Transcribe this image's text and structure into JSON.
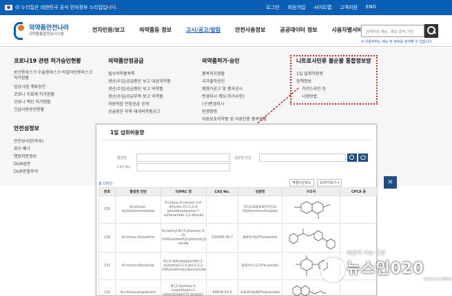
{
  "govbar": {
    "text": "이 누리집은 대한민국 공식 전자정부 누리집입니다.",
    "links": [
      "로그인",
      "회원가입",
      "사이트맵",
      "고객지원",
      "ENG"
    ]
  },
  "header": {
    "logo_name": "의약품안전나라",
    "logo_sub": "의약품통합정보시스템",
    "nav": [
      "전자민원/보고",
      "의약품등 정보",
      "고시/공고/알림",
      "안전사용정보",
      "공공데이터 정보",
      "사용자별서비스"
    ],
    "active_nav": "고시/공고/알림",
    "search_placeholder": "검색어와 메뉴, 정보 검색 가능",
    "search_tip": "※ 이용하려는 메뉴 및 정보를 검색할 수 있습니다."
  },
  "menu": {
    "col1": {
      "title": "코로나19 관련 허가승인현황",
      "items": [
        "보건용마스크·수술용마스크·비말차단용마스크 허가현황",
        "임상시험 계획승인",
        "코로나 치료제 허가현황",
        "코로나 백신 허가현황",
        "긴급사용승인현황"
      ],
      "title2": "안전성정보",
      "items2": [
        "안전성서한(속보)",
        "회수·폐기",
        "행정처분정보",
        "DUR성분",
        "DUR분할주의"
      ]
    },
    "col2": {
      "title": "의약품안정공급",
      "items": [
        "필수의약품목록",
        "생산/수입/공급중단 보고 대상의약품",
        "생산/수입/공급중단 보고 의약품",
        "생산/수입/공급부족 보고 의약품",
        "자원적합 안정공급 공개",
        "공급중단·부족·재개의약품공고"
      ]
    },
    "col3": {
      "title": "의약품허가·승인",
      "items": [
        "품목허가현황",
        "국가출하승인",
        "제형가공고 및 평과공시",
        "변경지시 계도(허가사항)",
        "(구)변경지시",
        "번경명령",
        "자료보호의약품 및 자료인용 품목현황"
      ]
    },
    "col4": {
      "title": "니트로사민류 불순물 통합정보방",
      "items": [
        "1일 섭취허용량",
        "정책정보"
      ],
      "subitems": [
        "가이드라인 등",
        "시험방법"
      ]
    }
  },
  "popup": {
    "title": "1일 섭취허용량",
    "label_name": "물질명",
    "label_cas": "CAS No.",
    "label_ingredient": "성분명 한번",
    "result_count": "총 135건",
    "tools": [
      "엑셀다운로드",
      "10개씩보기 ▾"
    ],
    "close_label": "×"
  },
  "table": {
    "headers": [
      "번호",
      "물질명 한번",
      "IUPAC 명",
      "CAS No.",
      "성분명",
      "구조식",
      "CPCA 등"
    ],
    "rows": [
      [
        "135",
        "N-nitroso-hydrochlorothiazide",
        "6-chloro-4-nitroso-3,4-dihydro-2H-1,2,4-benzothiadiazine-7-sulfonamide 1,1-dioxide",
        "",
        "하이드로클로로티아지드(Hydrochlorothiazide)",
        "",
        ""
      ],
      [
        "134",
        "N-nitroso-fluoxetine",
        "N-methyl-N-[3-phenoxy-3-(4-(trifluoromethyl)phenoxy)propyl]nitrous amide",
        "150494-06-7",
        "플루옥세틴(Fluoxetine)",
        "",
        ""
      ],
      [
        "133",
        "N-nitroso-flecainide",
        "N-((1-Nitrosopiperidin-2-yl)methyl)-2,5-bis(2,2,2-trifluoroethoxy)benzamide",
        "",
        "플레카이니드(Flecainide)",
        "",
        ""
      ],
      [
        "132",
        "N-nitroso-propranolol",
        "N-[2-hydroxy-3-(naphthalen-1-yloxy)propyl]-N-(propan-2-yl)nitrous amide",
        "84418-35-9",
        "프로프라놀롤(Propranolol)",
        "",
        ""
      ]
    ]
  },
  "watermark": {
    "sub": "희망이 가는 신문",
    "main": "뉴스인020",
    "eng": "Online to Offline"
  },
  "colors": {
    "govbar": "#0a5fb5",
    "accent": "#1a5fc8",
    "highlight_box": "#d62020",
    "dark_button": "#1f4e86"
  }
}
